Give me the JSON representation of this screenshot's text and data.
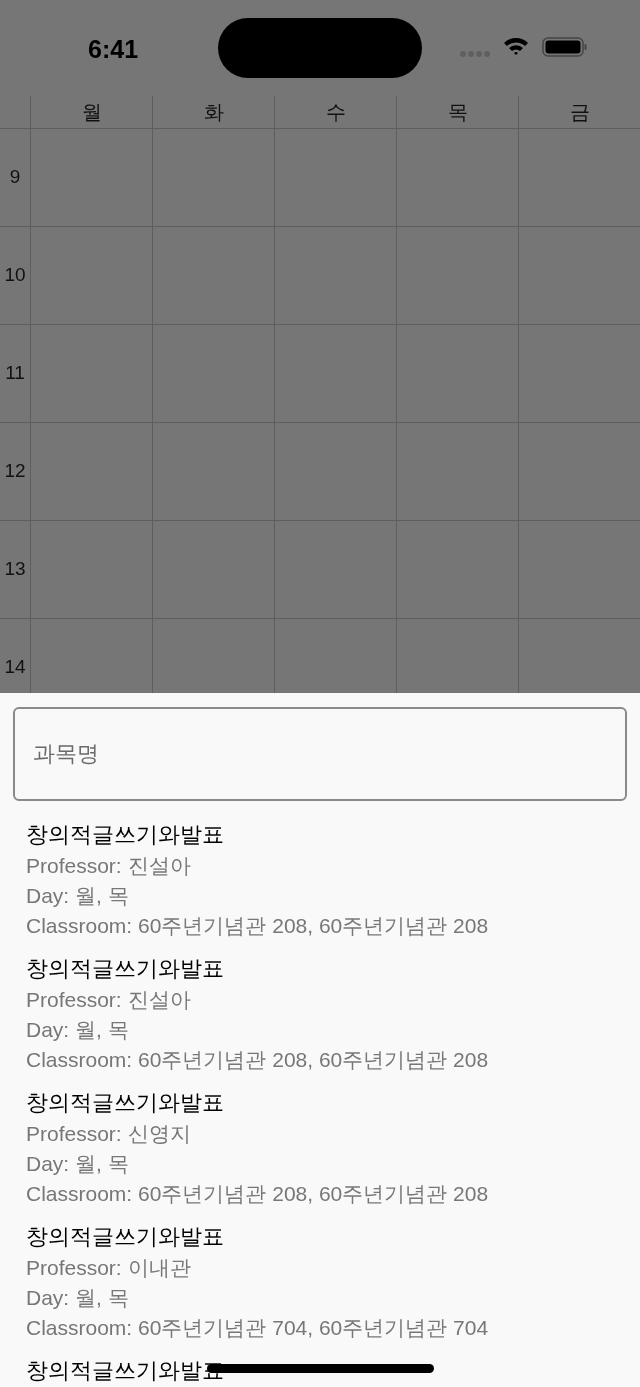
{
  "status_bar": {
    "time": "6:41"
  },
  "timetable": {
    "days": [
      "월",
      "화",
      "수",
      "목",
      "금"
    ],
    "hours": [
      "9",
      "10",
      "11",
      "12",
      "13",
      "14"
    ]
  },
  "search": {
    "placeholder": "과목명"
  },
  "courses": [
    {
      "title": "창의적글쓰기와발표",
      "professor": "Professor: 진설아",
      "day": "Day: 월, 목",
      "classroom": "Classroom: 60주년기념관 208, 60주년기념관 208"
    },
    {
      "title": "창의적글쓰기와발표",
      "professor": "Professor: 진설아",
      "day": "Day: 월, 목",
      "classroom": "Classroom: 60주년기념관 208, 60주년기념관 208"
    },
    {
      "title": "창의적글쓰기와발표",
      "professor": "Professor: 신영지",
      "day": "Day: 월, 목",
      "classroom": "Classroom: 60주년기념관 208, 60주년기념관 208"
    },
    {
      "title": "창의적글쓰기와발표",
      "professor": "Professor: 이내관",
      "day": "Day: 월, 목",
      "classroom": "Classroom: 60주년기념관 704, 60주년기념관 704"
    },
    {
      "title": "창의적글쓰기와발표"
    }
  ]
}
